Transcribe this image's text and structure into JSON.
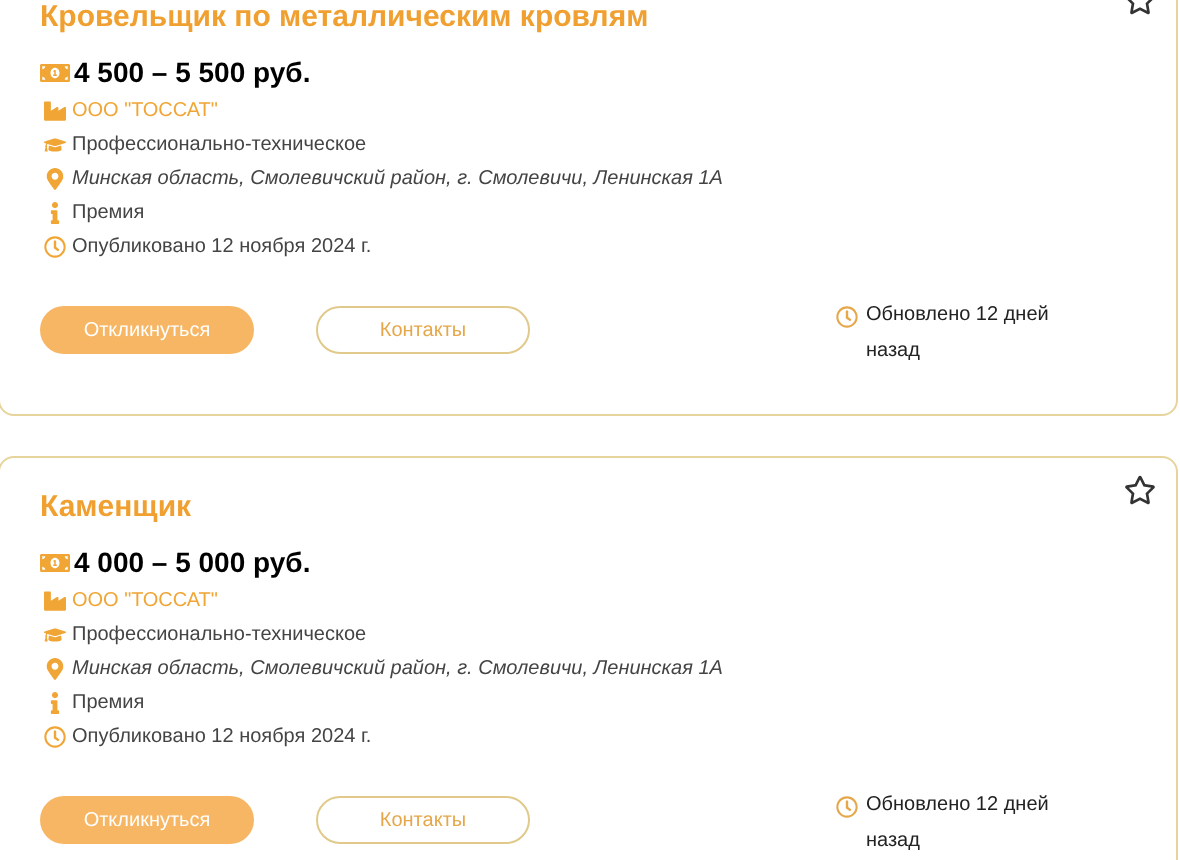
{
  "vacancies": [
    {
      "title": "Кровельщик по металлическим кровлям",
      "starred": false,
      "salary": "4 500 – 5 500 руб.",
      "details": [
        {
          "kind": "company",
          "text": "ООО \"ТОССАТ\""
        },
        {
          "kind": "education",
          "text": "Профессионально-техническое"
        },
        {
          "kind": "location",
          "text": "Минская область, Смолевичский район, г. Смолевичи, Ленинская 1А"
        },
        {
          "kind": "bonus",
          "text": "Премия"
        },
        {
          "kind": "published",
          "text": "Опубликовано 12 ноября 2024 г."
        }
      ],
      "apply": "Откликнуться",
      "contacts": "Контакты",
      "updated": "Обновлено 12 дней назад"
    },
    {
      "title": "Каменщик",
      "starred": false,
      "salary": "4 000 – 5 000 руб.",
      "details": [
        {
          "kind": "company",
          "text": "ООО \"ТОССАТ\""
        },
        {
          "kind": "education",
          "text": "Профессионально-техническое"
        },
        {
          "kind": "location",
          "text": "Минская область, Смолевичский район, г. Смолевичи, Ленинская 1А"
        },
        {
          "kind": "bonus",
          "text": "Премия"
        },
        {
          "kind": "published",
          "text": "Опубликовано 12 ноября 2024 г."
        }
      ],
      "apply": "Откликнуться",
      "contacts": "Контакты",
      "updated": "Обновлено 12 дней назад"
    }
  ]
}
